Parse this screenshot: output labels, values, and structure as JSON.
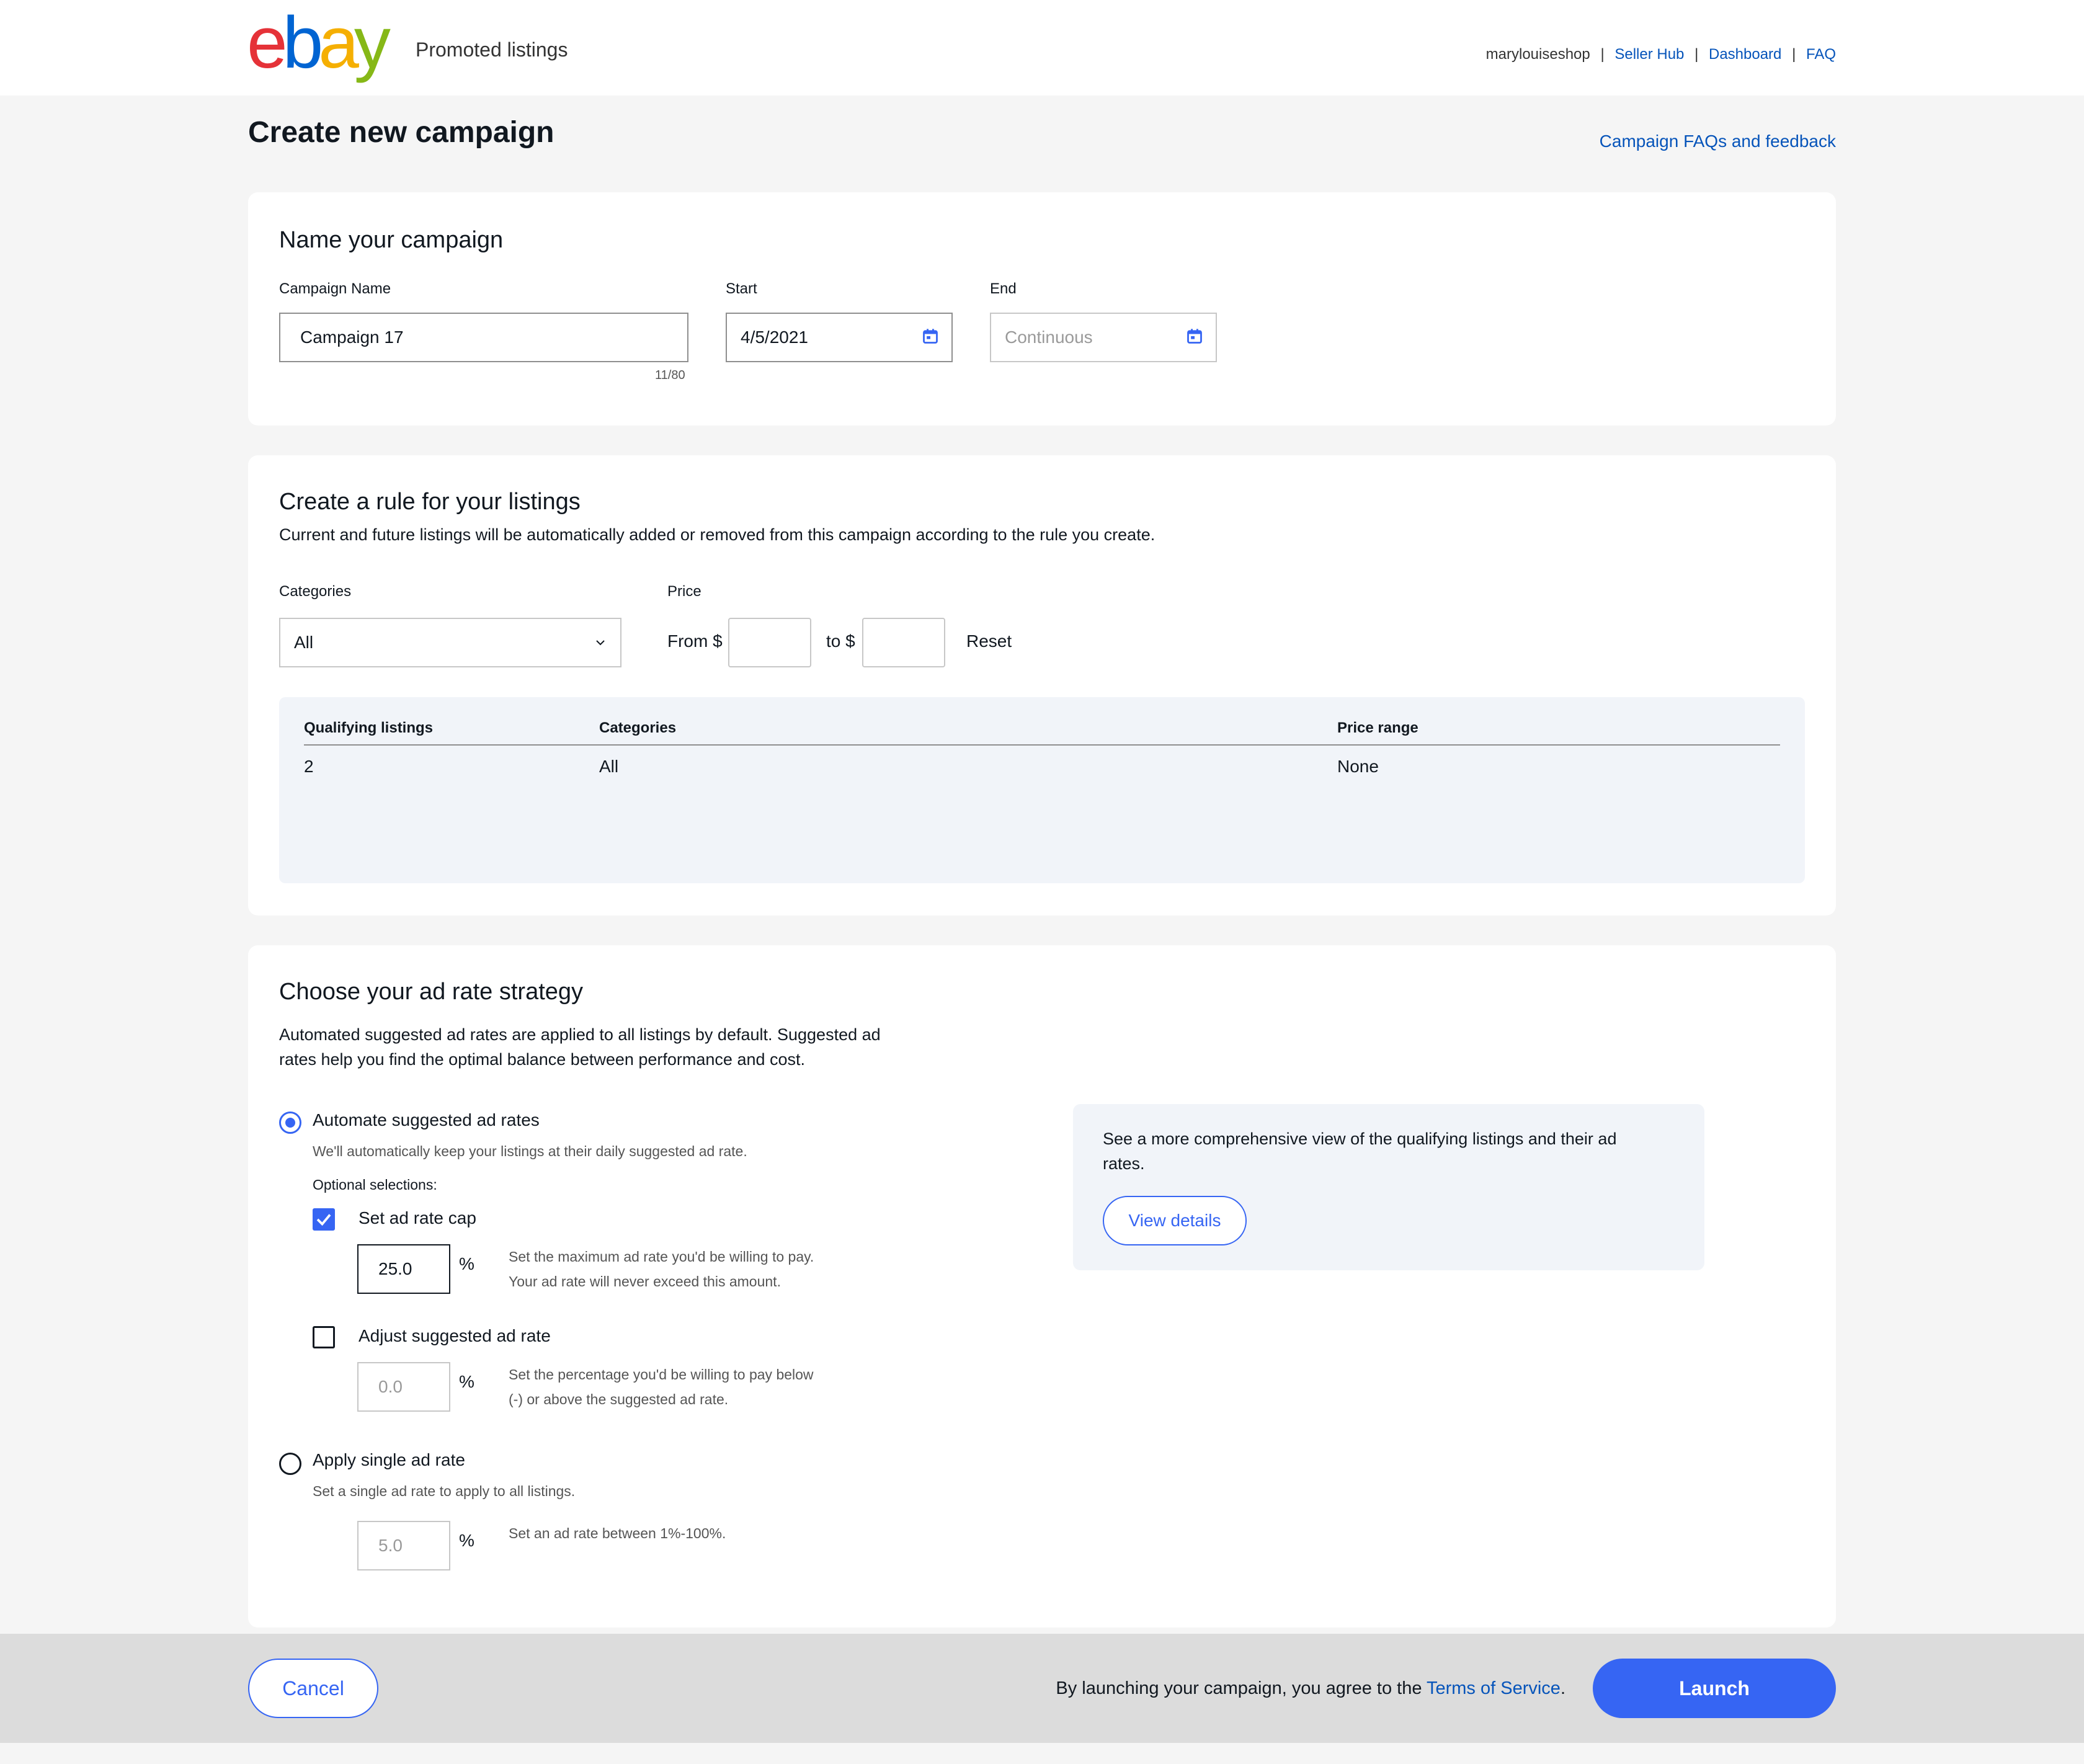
{
  "header": {
    "logo": "ebay",
    "subtitle": "Promoted listings",
    "username": "marylouiseshop",
    "links": [
      "Seller Hub",
      "Dashboard",
      "FAQ"
    ],
    "separator": "|"
  },
  "page": {
    "title": "Create new campaign",
    "faq_link": "Campaign FAQs and feedback"
  },
  "name_section": {
    "title": "Name your campaign",
    "campaign_name_label": "Campaign Name",
    "campaign_name_value": "Campaign 17",
    "char_counter": "11/80",
    "start_label": "Start",
    "start_value": "4/5/2021",
    "end_label": "End",
    "end_placeholder": "Continuous"
  },
  "rule_section": {
    "title": "Create a rule for your listings",
    "description": "Current and future listings will be automatically added or removed from this campaign according to the rule you create.",
    "categories_label": "Categories",
    "categories_value": "All",
    "price_label": "Price",
    "from_label": "From $",
    "to_label": "to $",
    "from_value": "",
    "to_value": "",
    "reset_label": "Reset",
    "table": {
      "headers": [
        "Qualifying listings",
        "Categories",
        "Price range"
      ],
      "row": [
        "2",
        "All",
        "None"
      ]
    }
  },
  "ad_rate_section": {
    "title": "Choose your ad rate strategy",
    "description_line1": "Automated suggested ad rates are applied to all listings by default. Suggested ad",
    "description_line2": "rates help you find the optimal balance between performance and cost.",
    "automate": {
      "label": "Automate suggested ad rates",
      "selected": true,
      "hint": "We'll automatically keep your listings at their daily suggested ad rate.",
      "optional_label": "Optional selections:"
    },
    "cap": {
      "label": "Set ad rate cap",
      "checked": true,
      "value": "25.0",
      "unit": "%",
      "hint_line1": "Set the maximum ad rate you'd be willing to pay.",
      "hint_line2": "Your ad rate will never exceed this amount."
    },
    "adjust": {
      "label": "Adjust suggested ad rate",
      "checked": false,
      "placeholder": "0.0",
      "unit": "%",
      "hint_line1": "Set the percentage you'd be willing to pay below",
      "hint_line2": "(-) or above the suggested ad rate."
    },
    "single": {
      "label": "Apply single ad rate",
      "selected": false,
      "hint": "Set a single ad rate to apply to all listings.",
      "placeholder": "5.0",
      "unit": "%",
      "rate_hint": "Set an ad rate between 1%-100%."
    },
    "info_box": {
      "text_line1": "See a more comprehensive view of the qualifying listings and their ad",
      "text_line2": "rates.",
      "button": "View details"
    }
  },
  "footer": {
    "cancel": "Cancel",
    "agree_prefix": "By launching your campaign, you agree to the ",
    "terms_link": "Terms of Service",
    "agree_suffix": ".",
    "launch": "Launch"
  },
  "colors": {
    "accent": "#3665f3",
    "link": "#0654ba",
    "page_bg": "#f5f5f5",
    "footer_bg": "#dcdcdc",
    "panel_bg": "#f1f4f9"
  }
}
